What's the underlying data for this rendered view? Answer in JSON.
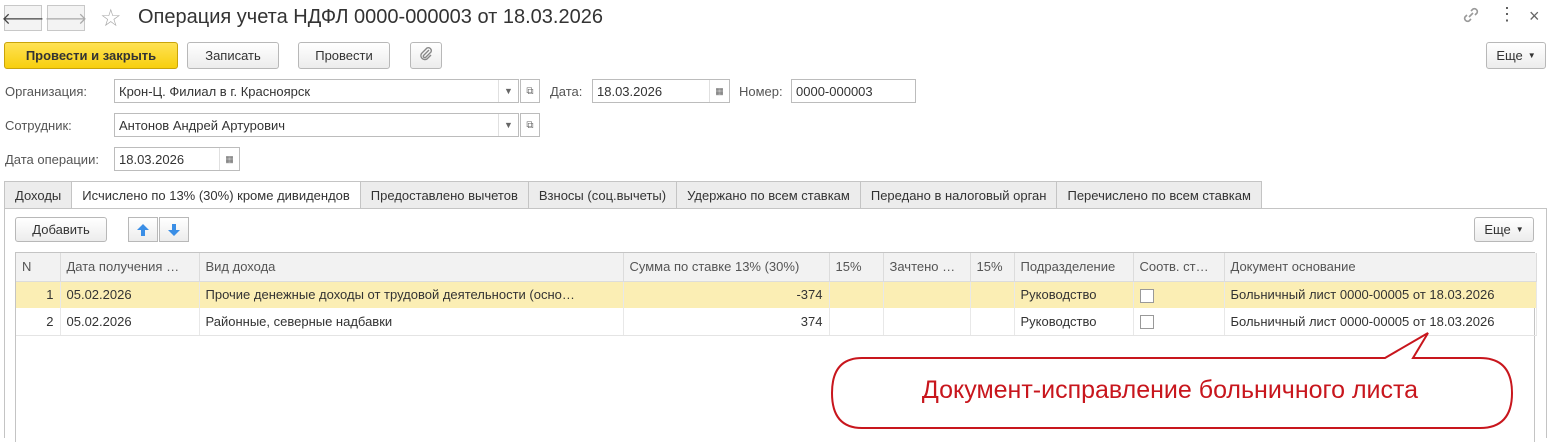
{
  "window": {
    "title": "Операция учета НДФЛ 0000-000003 от 18.03.2026"
  },
  "toolbar": {
    "post_close": "Провести и закрыть",
    "save": "Записать",
    "post": "Провести",
    "more": "Еще"
  },
  "form": {
    "org_label": "Организация:",
    "org_value": "Крон-Ц. Филиал в г. Красноярск",
    "date_label": "Дата:",
    "date_value": "18.03.2026",
    "number_label": "Номер:",
    "number_value": "0000-000003",
    "employee_label": "Сотрудник:",
    "employee_value": "Антонов Андрей Артурович",
    "opdate_label": "Дата операции:",
    "opdate_value": "18.03.2026"
  },
  "tabs": [
    {
      "label": "Доходы"
    },
    {
      "label": "Исчислено по 13% (30%) кроме дивидендов"
    },
    {
      "label": "Предоставлено вычетов"
    },
    {
      "label": "Взносы (соц.вычеты)"
    },
    {
      "label": "Удержано по всем ставкам"
    },
    {
      "label": "Передано в налоговый орган"
    },
    {
      "label": "Перечислено по всем ставкам"
    }
  ],
  "panel": {
    "add": "Добавить",
    "more": "Еще"
  },
  "table": {
    "columns": [
      "N",
      "Дата получения …",
      "Вид дохода",
      "Сумма по ставке 13% (30%)",
      "15%",
      "Зачтено …",
      "15%",
      "Подразделение",
      "Соотв. ст…",
      "Документ основание"
    ],
    "rows": [
      {
        "n": "1",
        "date": "05.02.2026",
        "kind": "Прочие денежные доходы от трудовой деятельности (осно…",
        "sum": "-374",
        "p15": "",
        "offset": "",
        "p15b": "",
        "dept": "Руководство",
        "doc": "Больничный лист 0000-00005 от 18.03.2026"
      },
      {
        "n": "2",
        "date": "05.02.2026",
        "kind": "Районные, северные надбавки",
        "sum": "374",
        "p15": "",
        "offset": "",
        "p15b": "",
        "dept": "Руководство",
        "doc": "Больничный лист 0000-00005 от 18.03.2026"
      }
    ]
  },
  "callout": {
    "text": "Документ-исправление больничного листа",
    "color": "#c8161d"
  },
  "icons": [
    "back-arrow-icon",
    "forward-arrow-icon",
    "star-icon",
    "link-icon",
    "menu-dots-icon",
    "close-icon",
    "paperclip-icon",
    "calendar-icon",
    "dropdown-icon",
    "open-icon",
    "arrow-up-icon",
    "arrow-down-icon"
  ]
}
